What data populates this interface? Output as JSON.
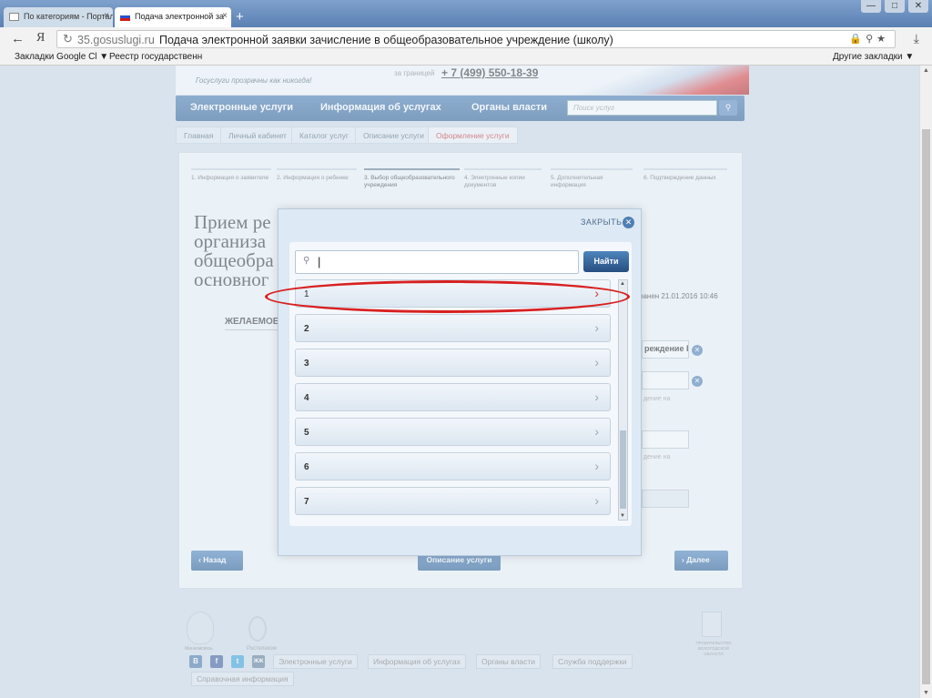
{
  "browser": {
    "tabs": [
      {
        "label": "По категориям - Портал",
        "close": "×"
      },
      {
        "label": "Подача электронной за",
        "close": "×"
      }
    ],
    "new_tab": "+",
    "window_controls": [
      "—",
      "□",
      "✕"
    ],
    "back": "←",
    "yandex": "Я",
    "address": {
      "host": "35.gosuslugi.ru",
      "title": "Подача электронной заявки зачисление в общеобразовательное учреждение (школу)"
    },
    "bookmarks": {
      "google": "Закладки Google Cl ▼",
      "registry": "Реестр государственн",
      "other": "Другие закладки ▼"
    }
  },
  "site": {
    "header": {
      "slogan": "Госуслуги прозрачны как никогда!",
      "abroad": "за границей",
      "phone": "+ 7 (499) 550-18-39"
    },
    "nav": {
      "items": [
        "Электронные услуги",
        "Информация об услугах",
        "Органы власти"
      ],
      "search_placeholder": "Поиск услуг"
    },
    "breadcrumbs": [
      "Главная",
      "Личный кабинет",
      "Каталог услуг",
      "Описание услуги",
      "Оформление услуги"
    ],
    "steps": [
      "1. Информация о заявителе",
      "2. Информация о ребенке",
      "3. Выбор общеобразовательного учреждения",
      "4. Электронные копии документов",
      "5. Дополнительная информация",
      "6. Подтверждение данных"
    ],
    "content": {
      "title": "Прием ре\nорганиза\nобщеобра\nосновног",
      "updated": "ранен 21.01.2016 10:46",
      "desired": "ЖЕЛАЕМОЕ",
      "field1": "реждение Гр",
      "ghost1": "дение на",
      "ghost2": "дение на",
      "back_label": "Назад",
      "desc_label": "Описание услуги",
      "next_label": "Далее"
    },
    "footer": {
      "links": [
        "Электронные услуги",
        "Информация об услугах",
        "Органы власти",
        "Служба поддержки",
        "Справочная информация"
      ],
      "social": [
        "В",
        "f",
        "t",
        "ЖЖ"
      ],
      "emblem_label": "Минкомсвязь",
      "rostel_label": "Ростелеком",
      "gov_label": "ПРАВИТЕЛЬСТВО ВОЛОГОДСКОЙ ОБЛАСТИ"
    }
  },
  "modal": {
    "close_label": "ЗАКРЫТЬ",
    "search_value": "|",
    "find_label": "Найти",
    "items": [
      "1",
      "2",
      "3",
      "4",
      "5",
      "6",
      "7"
    ],
    "highlight_color": "#d82020"
  }
}
